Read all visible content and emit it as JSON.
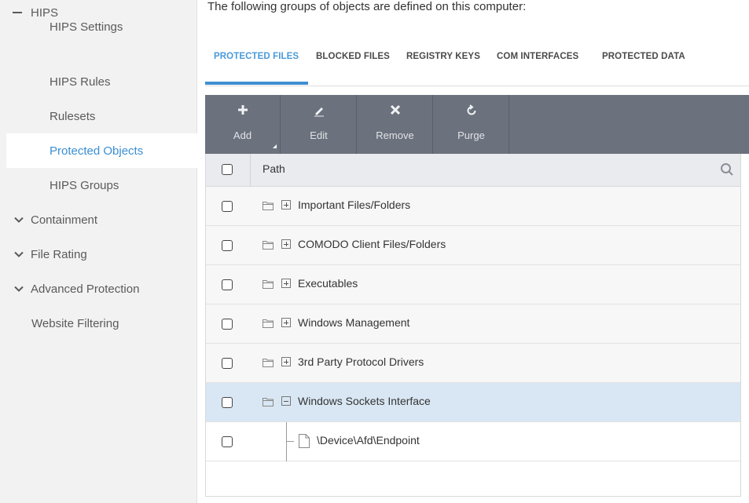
{
  "sidebar": {
    "items": [
      {
        "label": "HIPS"
      },
      {
        "label": "HIPS Settings"
      },
      {
        "label": "HIPS Rules"
      },
      {
        "label": "Rulesets"
      },
      {
        "label": "Protected Objects"
      },
      {
        "label": "HIPS Groups"
      },
      {
        "label": "Containment"
      },
      {
        "label": "File Rating"
      },
      {
        "label": "Advanced Protection"
      },
      {
        "label": "Website Filtering"
      }
    ]
  },
  "main": {
    "intro": "The following groups of objects are defined on this computer:",
    "tabs": [
      {
        "label": "PROTECTED FILES"
      },
      {
        "label": "BLOCKED FILES"
      },
      {
        "label": "REGISTRY KEYS"
      },
      {
        "label": "COM INTERFACES"
      },
      {
        "label": "PROTECTED DATA"
      }
    ],
    "toolbar": {
      "buttons": [
        {
          "label": "Add",
          "icon": "plus-icon"
        },
        {
          "label": "Edit",
          "icon": "pencil-icon"
        },
        {
          "label": "Remove",
          "icon": "x-icon"
        },
        {
          "label": "Purge",
          "icon": "refresh-icon"
        }
      ]
    },
    "table": {
      "header": "Path",
      "rows": [
        {
          "label": "Important Files/Folders",
          "expanded": false
        },
        {
          "label": "COMODO Client Files/Folders",
          "expanded": false
        },
        {
          "label": "Executables",
          "expanded": false
        },
        {
          "label": "Windows Management",
          "expanded": false
        },
        {
          "label": "3rd Party Protocol Drivers",
          "expanded": false
        },
        {
          "label": "Windows Sockets Interface",
          "expanded": true
        }
      ],
      "child": {
        "label": "\\Device\\Afd\\Endpoint"
      }
    }
  },
  "colors": {
    "accent": "#3f8fd2",
    "toolbar_bg": "#6b717d",
    "selected_row": "#d9e7f4",
    "sidebar_bg": "#f2f2f2"
  }
}
